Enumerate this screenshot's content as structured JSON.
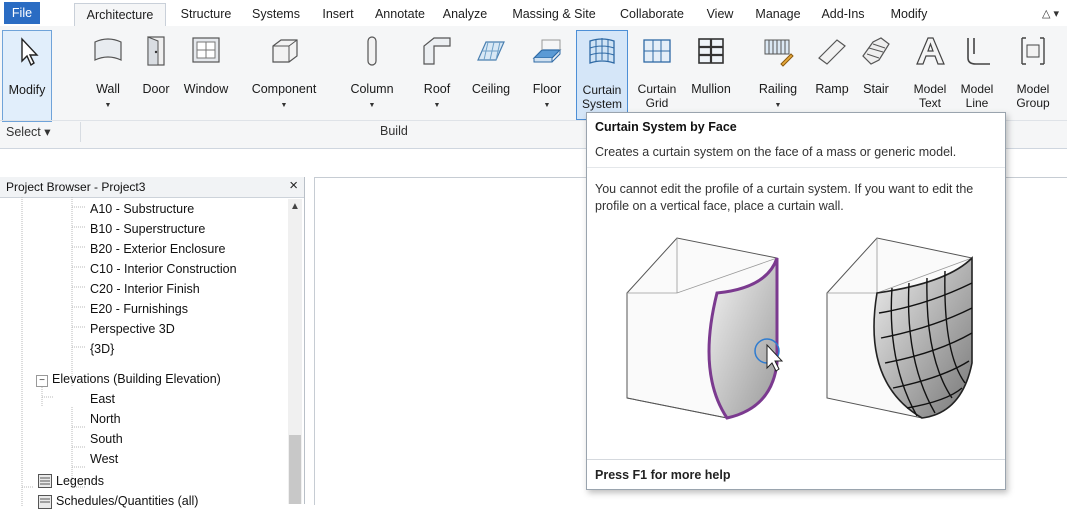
{
  "tabs": [
    "File",
    "Architecture",
    "Structure",
    "Systems",
    "Insert",
    "Annotate",
    "Analyze",
    "Massing & Site",
    "Collaborate",
    "View",
    "Manage",
    "Add-Ins",
    "Modify"
  ],
  "active_tab": "Architecture",
  "tab_extra": "△ ▾",
  "ribbon": {
    "tools": {
      "modify": "Modify",
      "wall": "Wall",
      "door": "Door",
      "window": "Window",
      "component": "Component",
      "column": "Column",
      "roof": "Roof",
      "ceiling": "Ceiling",
      "floor": "Floor",
      "curtain_system": "Curtain System",
      "curtain_grid": "Curtain Grid",
      "mullion": "Mullion",
      "railing": "Railing",
      "ramp": "Ramp",
      "stair": "Stair",
      "model_text": "Model Text",
      "model_line": "Model Line",
      "model_group": "Model Group"
    },
    "panels": {
      "select": "Select ▾",
      "build": "Build"
    },
    "dropdown_arrow": "▼"
  },
  "browser": {
    "title": "Project Browser - Project3",
    "close": "×",
    "items": [
      {
        "label": "A10 - Substructure"
      },
      {
        "label": "B10 - Superstructure"
      },
      {
        "label": "B20 - Exterior Enclosure"
      },
      {
        "label": "C10 - Interior Construction"
      },
      {
        "label": "C20 - Interior Finish"
      },
      {
        "label": "E20 - Furnishings"
      },
      {
        "label": "Perspective 3D"
      },
      {
        "label": "{3D}"
      },
      {
        "label": "Elevations (Building Elevation)"
      },
      {
        "label": "East"
      },
      {
        "label": "North"
      },
      {
        "label": "South"
      },
      {
        "label": "West"
      },
      {
        "label": "Legends"
      },
      {
        "label": "Schedules/Quantities (all)"
      }
    ],
    "collapse_glyph": "−",
    "scroll_up": "▲"
  },
  "tooltip": {
    "title": "Curtain System by Face",
    "description": "Creates a curtain system on the face of a mass or generic model.",
    "note": "You cannot edit the profile of a curtain system. If you want to edit the profile on a vertical face, place a curtain wall.",
    "footer": "Press F1 for more help"
  },
  "colors": {
    "file_tab": "#2a6cc3",
    "highlight_border": "#4d8fd6",
    "illustration_outline": "#7b3a8f"
  }
}
